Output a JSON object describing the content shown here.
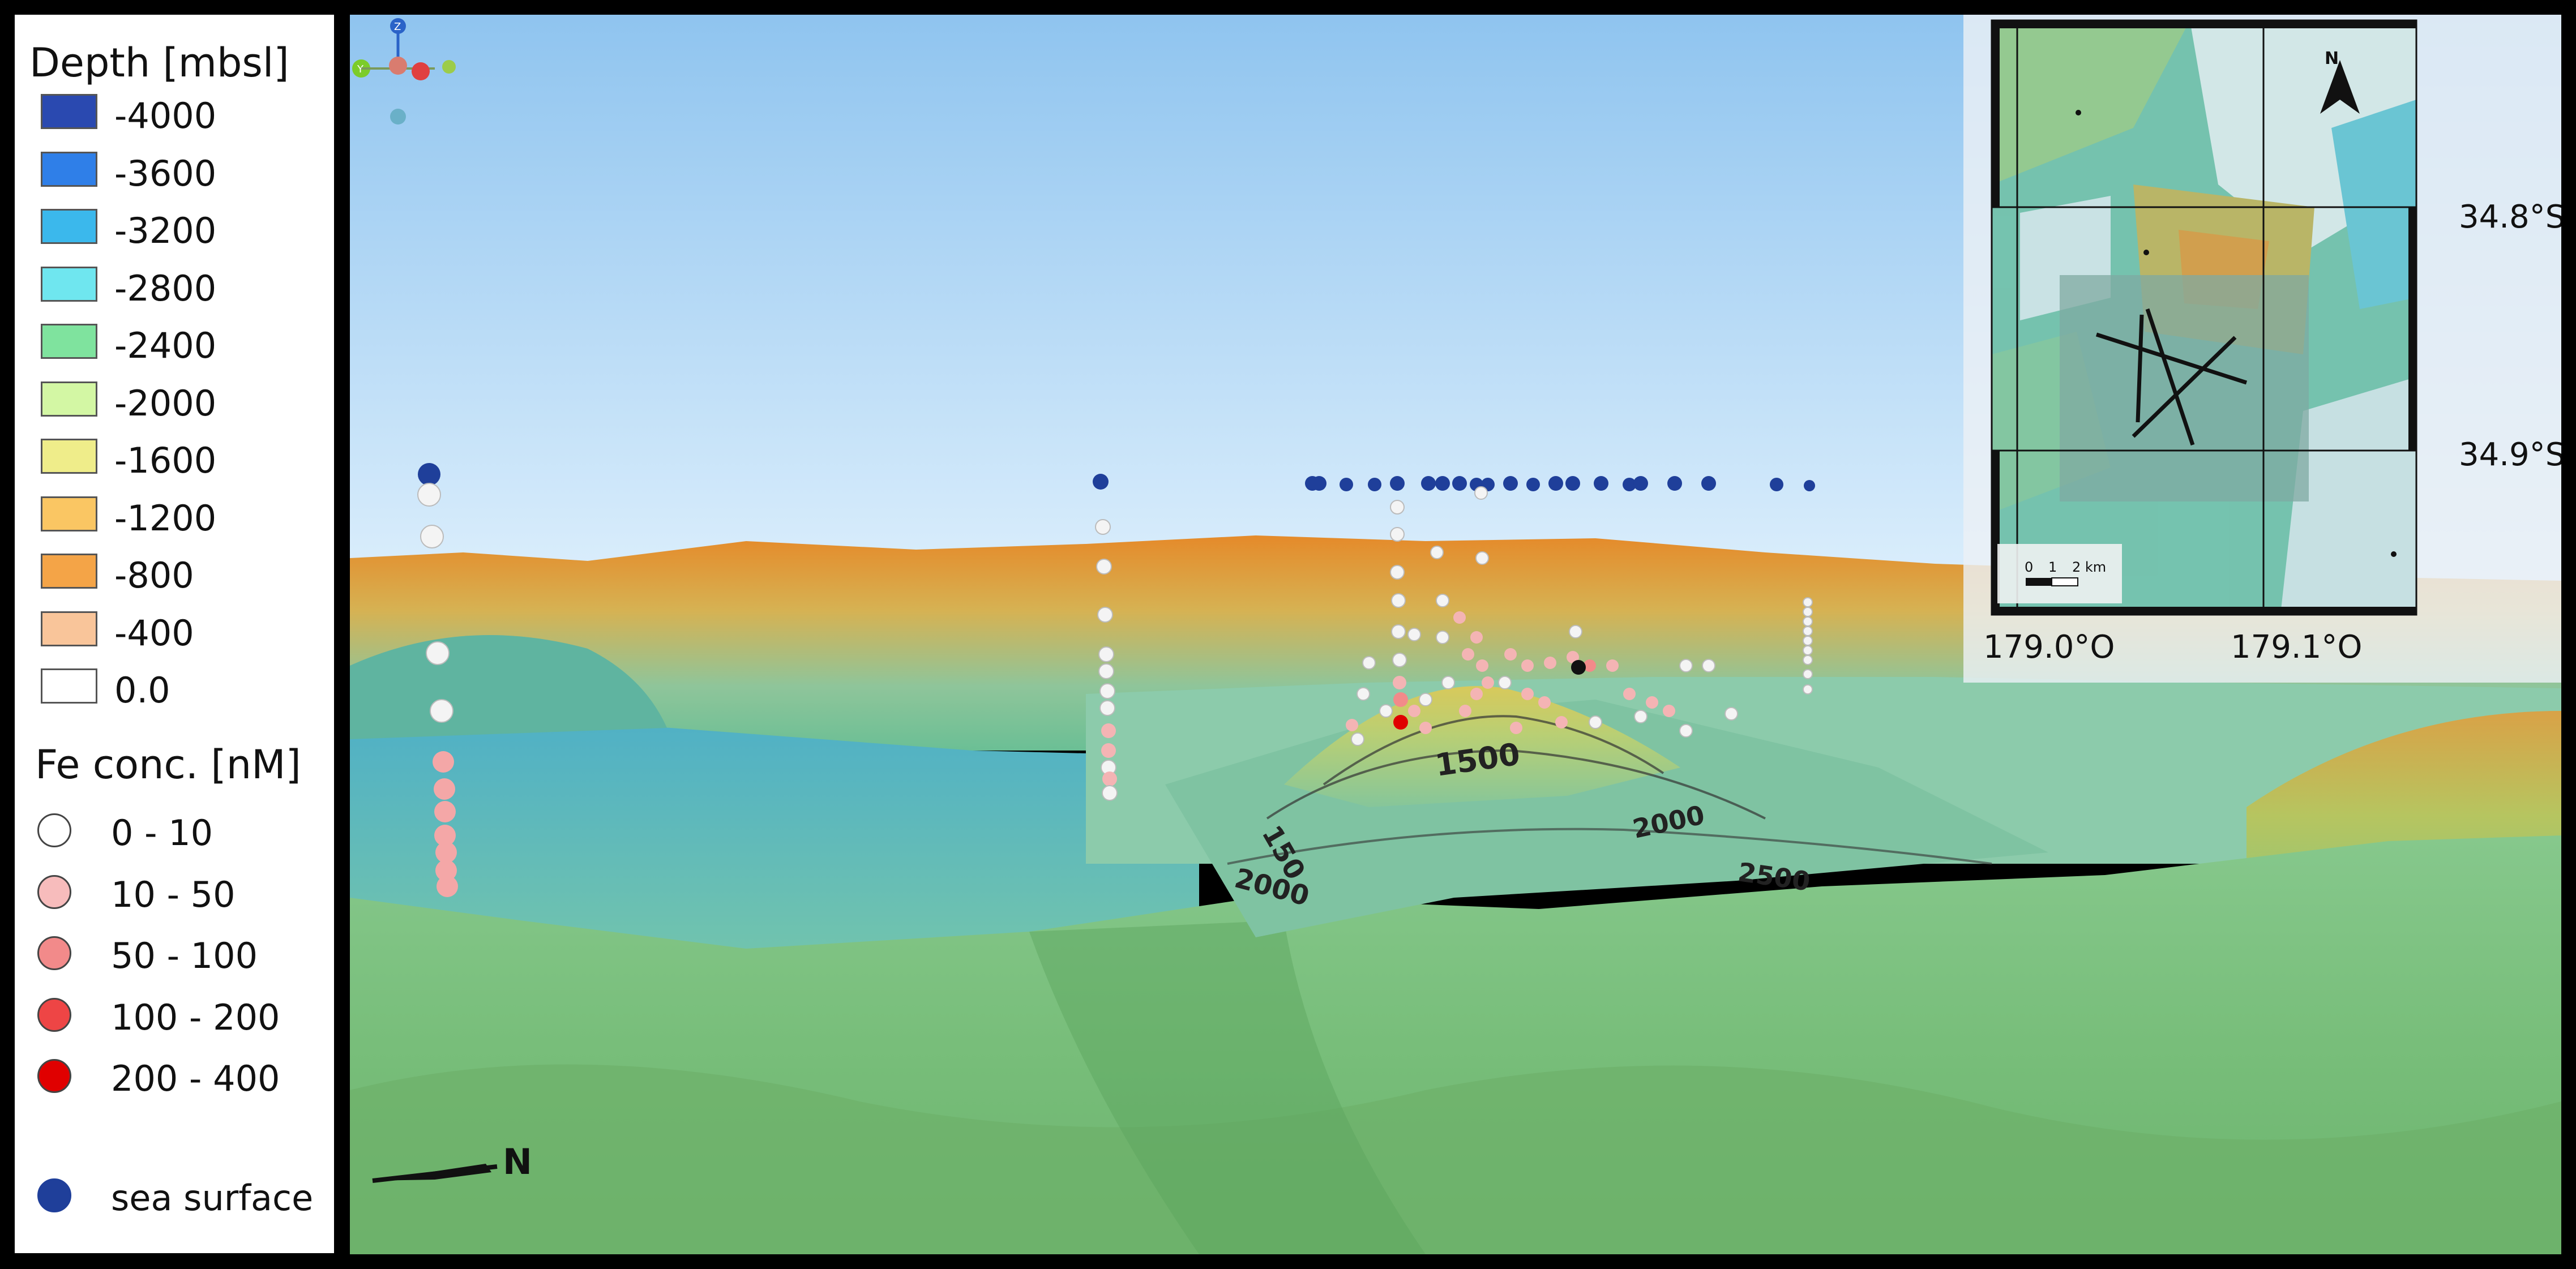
{
  "legend": {
    "depth_title": "Depth [mbsl]",
    "depth_items": [
      {
        "label": "-4000",
        "color": "#2a49b0"
      },
      {
        "label": "-3600",
        "color": "#2f7fe8"
      },
      {
        "label": "-3200",
        "color": "#3bb8ec"
      },
      {
        "label": "-2800",
        "color": "#6fe6ef"
      },
      {
        "label": "-2400",
        "color": "#7fe39e"
      },
      {
        "label": "-2000",
        "color": "#d3f7a4"
      },
      {
        "label": "-1600",
        "color": "#efed8a"
      },
      {
        "label": "-1200",
        "color": "#fac663"
      },
      {
        "label": "-800",
        "color": "#f4a447"
      },
      {
        "label": "-400",
        "color": "#f9c59a"
      },
      {
        "label": "0.0",
        "color": "#ffffff"
      }
    ],
    "fe_title": "Fe conc. [nM]",
    "fe_items": [
      {
        "label": "0 - 10",
        "color": "#ffffff"
      },
      {
        "label": "10 - 50",
        "color": "#f7bcbc"
      },
      {
        "label": "50 - 100",
        "color": "#f28a8a"
      },
      {
        "label": "100 - 200",
        "color": "#ee4545"
      },
      {
        "label": "200 - 400",
        "color": "#e00000"
      }
    ],
    "sea_surface": {
      "label": "sea surface",
      "color": "#1f3f9a"
    }
  },
  "scene": {
    "north_label": "N",
    "contour_labels": [
      "1500",
      "150",
      "2000",
      "2000",
      "2500"
    ]
  },
  "inset": {
    "north": "N",
    "lat_labels": [
      "34.8°S",
      "34.9°S"
    ],
    "lon_labels": [
      "179.0°O",
      "179.1°O"
    ],
    "scale_ticks": [
      "0",
      "1",
      "2 km"
    ]
  },
  "axes": {
    "z": "Z",
    "y": "Y"
  }
}
